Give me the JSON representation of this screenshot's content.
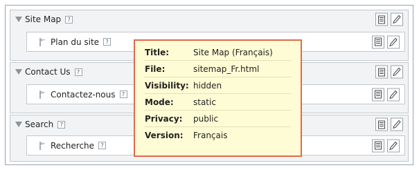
{
  "sections": [
    {
      "title": "Site Map",
      "child": "Plan du site"
    },
    {
      "title": "Contact Us",
      "child": "Contactez-nous"
    },
    {
      "title": "Search",
      "child": "Recherche"
    }
  ],
  "help_glyph": "?",
  "icons": {
    "expanded": "triangle-down-icon",
    "page": "flag-icon",
    "properties": "properties-icon",
    "edit": "edit-pencil-icon"
  },
  "tooltip": {
    "rows": [
      {
        "key": "Title:",
        "value": "Site Map (Français)"
      },
      {
        "key": "File:",
        "value": "sitemap_Fr.html"
      },
      {
        "key": "Visibility:",
        "value": "hidden"
      },
      {
        "key": "Mode:",
        "value": "static"
      },
      {
        "key": "Privacy:",
        "value": "public"
      },
      {
        "key": "Version:",
        "value": "Français"
      }
    ]
  },
  "colors": {
    "tooltip_border": "#e06a4a",
    "tooltip_bg": "#fefcd4",
    "section_bg": "#f1f3f5"
  }
}
